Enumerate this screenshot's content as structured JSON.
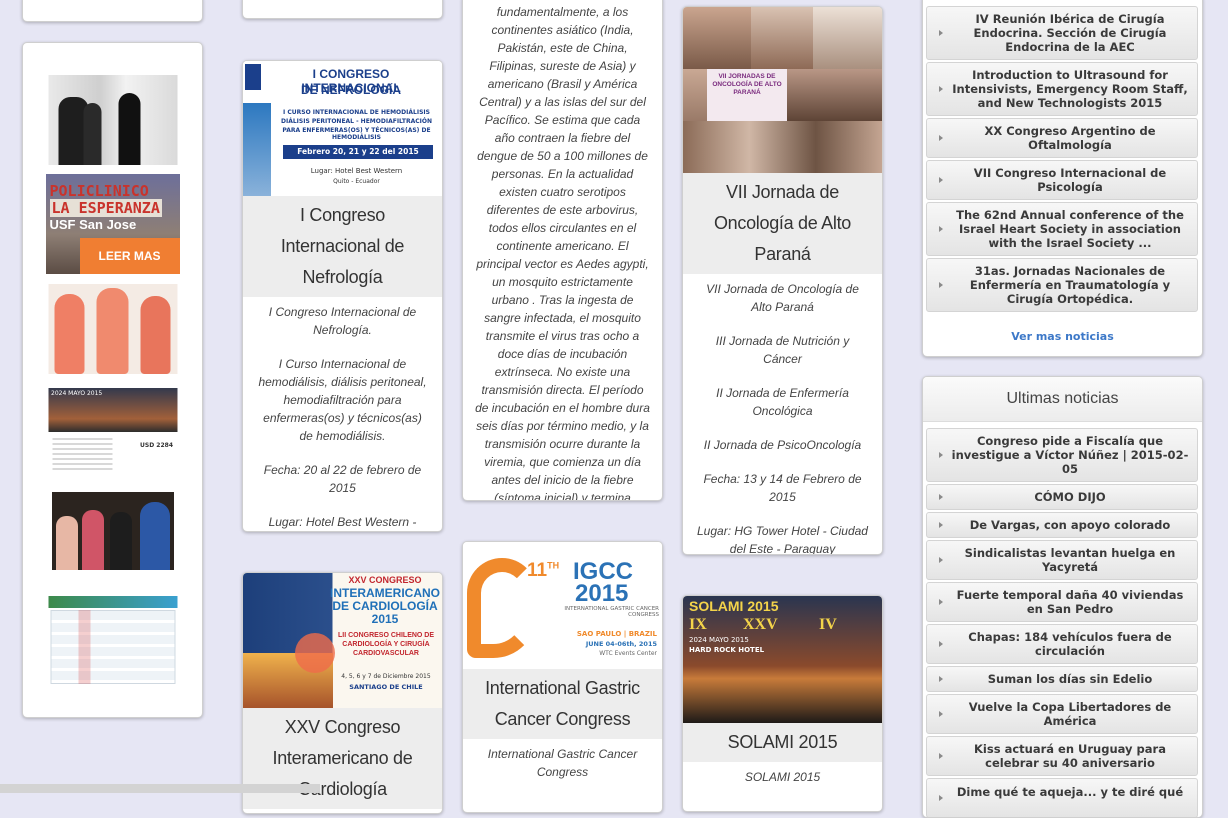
{
  "left_gallery": {
    "leer_mas": "LEER MAS",
    "clinic_sign_line1": "POLICLINICO",
    "clinic_sign_line2": "LA ESPERANZA",
    "clinic_sign_line3": "USF San Jose",
    "hotel_thumb_price": "USD 2284",
    "hotel_thumb_year": "2024 MAYO 2015"
  },
  "cards": [
    {
      "banner_top": "I CONGRESO INTERNACIONAL",
      "banner_sub": "DE NEFROLOGÍA",
      "banner_lines": [
        "I CURSO INTERNACIONAL DE HEMODIÁLISIS",
        "DIÁLISIS PERITONEAL - HEMODIAFILTRACIÓN",
        "PARA ENFERMERAS(OS) Y TÉCNICOS(AS) DE HEMODIÁLISIS"
      ],
      "banner_date": "Febrero 20, 21 y 22 del 2015",
      "banner_place": "Lugar: Hotel Best Western",
      "banner_city": "Quito - Ecuador",
      "title": "I Congreso Internacional de Nefrología",
      "p1": "I Congreso Internacional de Nefrología.",
      "p2": "I Curso Internacional de hemodiálisis, diálisis peritoneal, hemodiafiltración para enfermeras(os) y técnicos(as) de hemodiálisis.",
      "p3": "Fecha: 20 al 22 de febrero de 2015",
      "p4": "Lugar: Hotel Best Western - Quito - Ecuador"
    },
    {
      "banner_top": "XXV CONGRESO",
      "banner_mid": "INTERAMERICANO DE CARDIOLOGÍA 2015",
      "banner_sub": "LII CONGRESO CHILENO DE CARDIOLOGÍA Y CIRUGÍA CARDIOVASCULAR",
      "banner_date": "4, 5, 6 y 7 de Diciembre 2015",
      "banner_city": "SANTIAGO DE CHILE",
      "title": "XXV Congreso Interamericano de Cardiología"
    },
    {
      "body": "fundamentalmente, a los continentes asiático (India, Pakistán, este de China, Filipinas, sureste de Asia) y americano (Brasil y América Central) y a las islas del sur del Pacífico. Se estima que cada año contraen la fiebre del dengue de 50 a 100 millones de personas. En la actualidad existen cuatro serotipos diferentes de este arbovirus, todos ellos circulantes en el continente americano. El principal vector es Aedes agypti, un mosquito estrictamente urbano . Tras la ingesta de sangre infectada, el mosquito transmite el virus tras ocho a doce días de incubación extrínseca. No existe una transmisión directa. El período de incubación en el hombre dura seis días por término medio, y la transmisión ocurre durante la viremia, que comienza un día antes del inicio de la fiebre (síntoma inicial) y  termina alrededor del sexto día de la enfermedad."
    },
    {
      "logo_num": "11",
      "logo_sup": "TH",
      "logo_name": "IGCC",
      "logo_year": "2015",
      "logo_sub": "INTERNATIONAL GASTRIC CANCER CONGRESS",
      "logo_city": "SAO PAULO | BRAZIL",
      "logo_date": "JUNE 04-06th, 2015",
      "logo_venue": "WTC Events Center",
      "title": "International Gastric Cancer Congress",
      "p1": "International Gastric Cancer Congress"
    },
    {
      "banner_title": "VII JORNADAS DE ONCOLOGÍA DE ALTO PARANÁ",
      "title": "VII Jornada de Oncología de Alto Paraná",
      "p1": "VII Jornada de Oncología de Alto Paraná",
      "p2": "III Jornada de Nutrición y Cáncer",
      "p3": "II Jornada de Enfermería Oncológica",
      "p4": "II Jornada de PsicoOncología",
      "p5": "Fecha: 13 y 14 de Febrero de 2015",
      "p6": "Lugar: HG Tower Hotel - Ciudad del Este - Paraguay"
    },
    {
      "banner_title": "SOLAMI 2015",
      "banner_roman1": "IX",
      "banner_roman2": "XXV",
      "banner_roman3": "IV",
      "banner_date": "2024 MAYO 2015",
      "banner_hotel": "HARD ROCK HOTEL",
      "title": "SOLAMI 2015",
      "p1": "SOLAMI 2015"
    }
  ],
  "events": {
    "items": [
      "IV Reunión Ibérica de Cirugía Endocrina. Sección de Cirugía Endocrina de la AEC",
      "Introduction to Ultrasound for Intensivists, Emergency Room Staff, and New Technologists 2015",
      "XX Congreso Argentino de Oftalmología",
      "VII Congreso Internacional de Psicología",
      "The 62nd Annual conference of the Israel Heart Society in association with the Israel Society ...",
      "31as. Jornadas Nacionales de Enfermería en Traumatología y Cirugía Ortopédica."
    ],
    "more": "Ver mas noticias"
  },
  "news": {
    "title": "Ultimas noticias",
    "items": [
      "Congreso pide a Fiscalía que investigue a Víctor Núñez | 2015-02-05",
      "CÓMO DIJO",
      "De Vargas, con apoyo colorado",
      "Sindicalistas levantan huelga en Yacyretá",
      "Fuerte temporal daña 40 viviendas en San Pedro",
      "Chapas: 184 vehículos fuera de circulación",
      "Suman los días sin Edelio",
      "Vuelve la Copa Libertadores de América",
      "Kiss actuará en Uruguay para celebrar su 40 aniversario",
      "Dime qué te aqueja... y te diré qué"
    ]
  }
}
